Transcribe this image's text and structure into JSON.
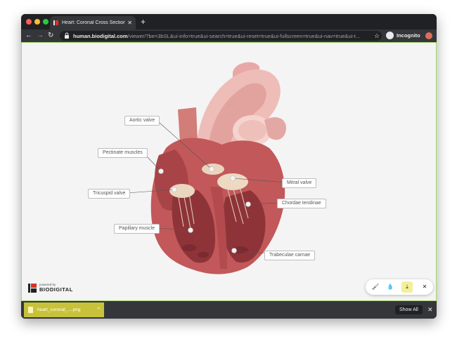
{
  "browser": {
    "tab_title": "Heart: Coronal Cross Section |",
    "tab_close": "✕",
    "new_tab": "+",
    "back": "←",
    "forward": "→",
    "reload": "↻",
    "url_host": "human.biodigital.com",
    "url_path": "/viewer/?be=3bSL&ui-info=true&ui-search=true&ui-reset=true&ui-fullscreen=true&ui-nav=true&ui-t...",
    "star": "☆",
    "profile_label": "Incognito"
  },
  "viewer": {
    "labels": [
      {
        "text": "Aortic valve"
      },
      {
        "text": "Pectinate muscles"
      },
      {
        "text": "Tricuspid valve"
      },
      {
        "text": "Papillary muscle"
      },
      {
        "text": "Mitral valve"
      },
      {
        "text": "Chordae tendinae"
      },
      {
        "text": "Trabeculae carnae"
      }
    ],
    "logo_small": "powered by",
    "logo": "BIODIGITAL",
    "controls": {
      "brush": "🖌",
      "drop": "💧",
      "download": "⤓",
      "close": "✕"
    }
  },
  "downloads": {
    "file_name": "heart_coronal_....png",
    "chevron": "^",
    "show_all": "Show All",
    "close": "✕"
  },
  "colors": {
    "accent_border": "#a6d66d",
    "download_item": "#c8c23a",
    "download_button_highlight": "#f3f09a"
  }
}
